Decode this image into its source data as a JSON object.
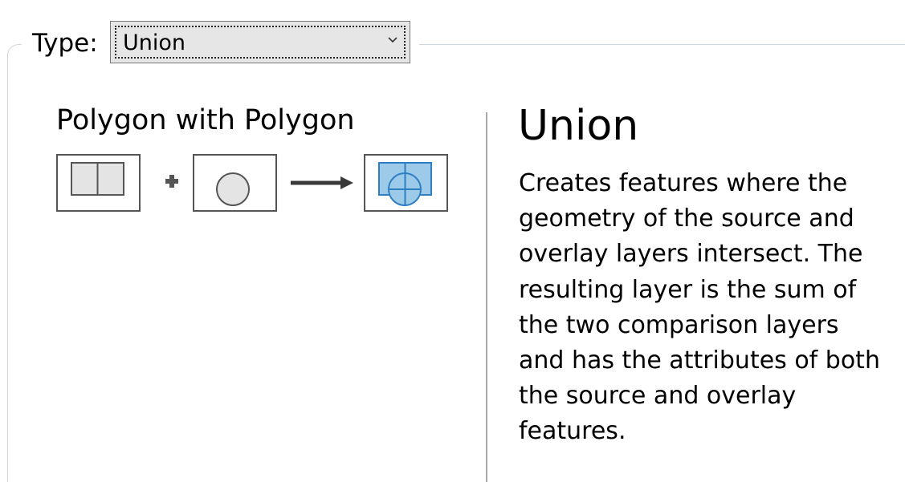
{
  "type_field": {
    "label": "Type:",
    "selected_value": "Union"
  },
  "diagram": {
    "title": "Polygon with Polygon",
    "icons": [
      "split-rectangle-polygon-icon",
      "plus-icon",
      "circle-polygon-icon",
      "arrow-right-icon",
      "union-result-icon"
    ]
  },
  "description": {
    "title": "Union",
    "text": "Creates features where the geometry of the source and overlay layers intersect. The resulting layer is the sum of the two comparison layers and has the attributes of both the source and overlay features."
  },
  "colors": {
    "group_border": "#cfd6dd",
    "select_background": "#e6e6e6",
    "result_fill": "#9ecae9",
    "result_stroke": "#2f7fc3",
    "icon_stroke": "#555555"
  }
}
